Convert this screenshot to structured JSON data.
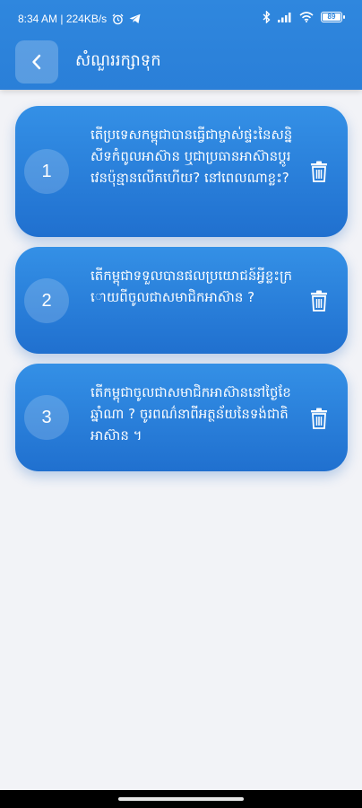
{
  "status_bar": {
    "time_info": "8:34 AM | 224KB/s",
    "icons": [
      "alarm-icon",
      "telegram-icon",
      "bluetooth-icon",
      "signal-icon",
      "wifi-icon",
      "battery-icon"
    ],
    "battery_level": "89"
  },
  "header": {
    "back_icon": "chevron-left-icon",
    "title": "សំណួររក្សាទុក"
  },
  "questions": [
    {
      "number": "1",
      "text": "តើប្រទេសកម្ពុជាបានធ្វើជាម្ចាស់ផ្ទះនៃសន្និសីទកំពូលអាស៊ាន ឬជាប្រធានអាស៊ានប្តូរវេនប៉ុន្មានលើកហើយ? នៅពេលណាខ្លះ?",
      "delete_icon": "trash-icon"
    },
    {
      "number": "2",
      "text": "តើកម្ពុជាទទួលបានផលប្រយោជន៍អ្វីខ្លះក្រោយពីចូលជាសមាជិកអាស៊ាន ?",
      "delete_icon": "trash-icon"
    },
    {
      "number": "3",
      "text": "តើកម្ពុជាចូលជាសមាជិកអាស៊ាននៅថ្ងៃខែឆ្នាំណា ? ចូរពណ៌នាពីអត្ថន័យនៃទង់ជាតិអាស៊ាន ។",
      "delete_icon": "trash-icon"
    }
  ],
  "colors": {
    "header_blue": "#2f87de",
    "card_blue_top": "#3490e6",
    "card_blue_bottom": "#2070cf",
    "background": "#f2f3f7"
  }
}
